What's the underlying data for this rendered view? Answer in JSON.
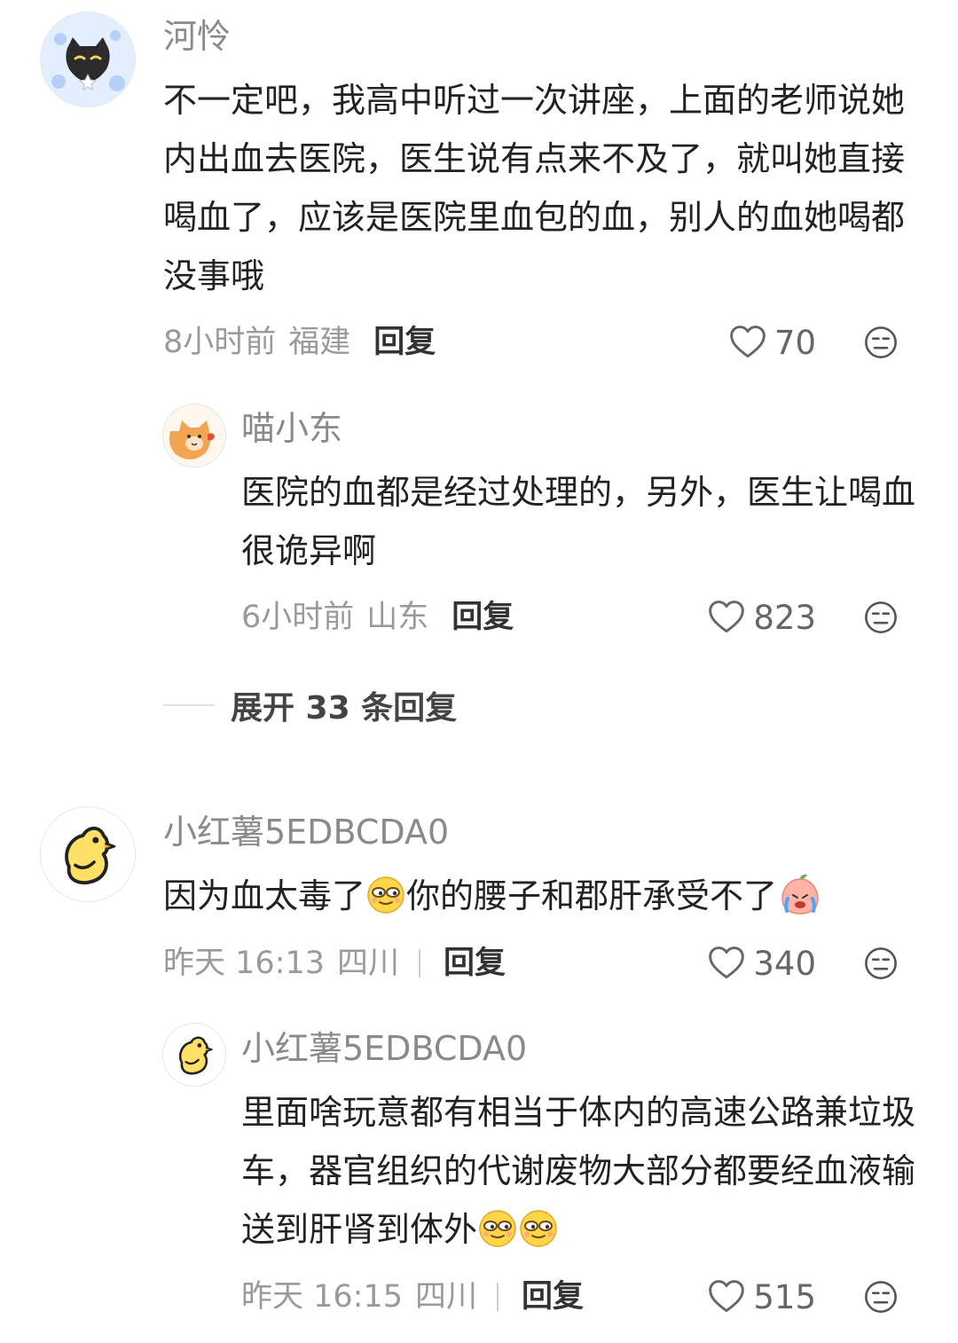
{
  "colors": {
    "text": "#222222",
    "name": "#8a8a8a",
    "meta": "#9a9a9a",
    "reply": "#333333",
    "icon": "#666666",
    "divider": "#e2e2e2"
  },
  "comments": [
    {
      "user": "河怜",
      "avatar_icon": "black-cat-avatar-icon",
      "text": "不一定吧，我高中听过一次讲座，上面的老师说她内出血去医院，医生说有点来不及了，就叫她直接喝血了，应该是医院里血包的血，别人的血她喝都没事哦",
      "time": "8小时前",
      "location": "福建",
      "reply": "回复",
      "likes": "70",
      "replies": [
        {
          "user": "喵小东",
          "avatar_icon": "orange-cat-avatar-icon",
          "text": "医院的血都是经过处理的，另外，医生让喝血很诡异啊",
          "time": "6小时前",
          "location": "山东",
          "reply": "回复",
          "likes": "823"
        }
      ],
      "expand_label": "展开 33 条回复"
    },
    {
      "user": "小红薯5EDBCDA0",
      "avatar_icon": "yellow-chick-avatar-icon",
      "text_parts": [
        "因为血太毒了",
        "你的腰子和郡肝承受不了"
      ],
      "text_emojis": [
        "smug-face-emoji",
        "crying-peach-emoji"
      ],
      "time": "昨天 16:13",
      "location": "四川",
      "reply": "回复",
      "likes": "340",
      "replies": [
        {
          "user": "小红薯5EDBCDA0",
          "avatar_icon": "yellow-chick-avatar-icon",
          "text": "里面啥玩意都有相当于体内的高速公路兼垃圾车，器官组织的代谢废物大部分都要经血液输送到肝肾到体外",
          "text_emojis": [
            "smug-face-emoji",
            "smug-face-emoji"
          ],
          "time": "昨天 16:15",
          "location": "四川",
          "reply": "回复",
          "likes": "515"
        }
      ]
    }
  ]
}
